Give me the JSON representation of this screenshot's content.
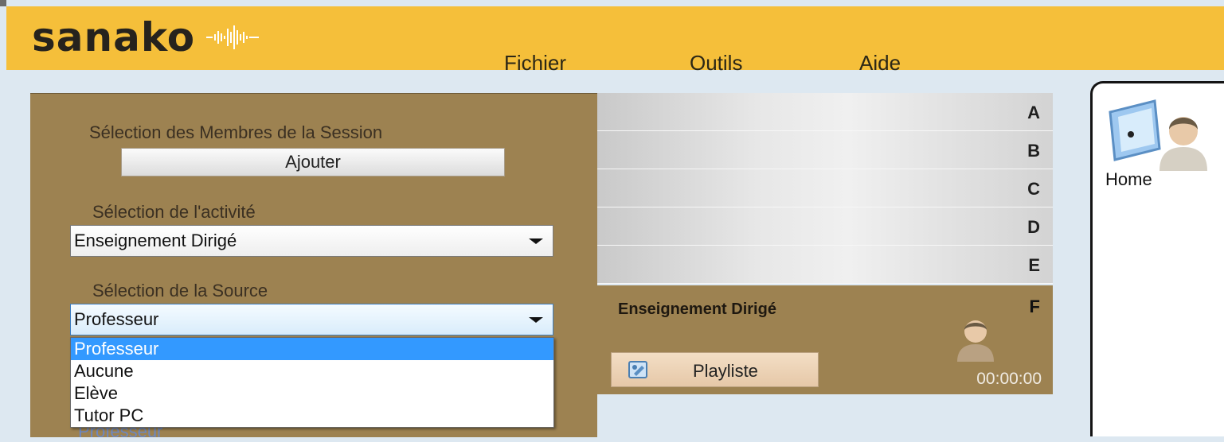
{
  "header": {
    "logo_text": "sanako",
    "menu": {
      "file": "Fichier",
      "tools": "Outils",
      "help": "Aide"
    }
  },
  "left_panel": {
    "members_label": "Sélection des Membres de la Session",
    "add_button": "Ajouter",
    "activity_label": "Sélection de l'activité",
    "activity_value": "Enseignement Dirigé",
    "source_label": "Sélection de la Source",
    "source_value": "Professeur",
    "source_options": [
      "Professeur",
      "Aucune",
      "Elève",
      "Tutor PC"
    ],
    "behind_text": "Professeur"
  },
  "groups": {
    "letters": [
      "A",
      "B",
      "C",
      "D",
      "E"
    ],
    "active": {
      "letter": "F",
      "title": "Enseignement Dirigé",
      "playlist_button": "Playliste",
      "timer": "00:00:00",
      "icon": "teacher-icon"
    }
  },
  "right_panel": {
    "home_label": "Home",
    "icon": "home-icon"
  },
  "colors": {
    "header": "#f5bf3a",
    "panel": "#9d8251",
    "selection": "#3399ff",
    "background": "#dde8f1"
  }
}
